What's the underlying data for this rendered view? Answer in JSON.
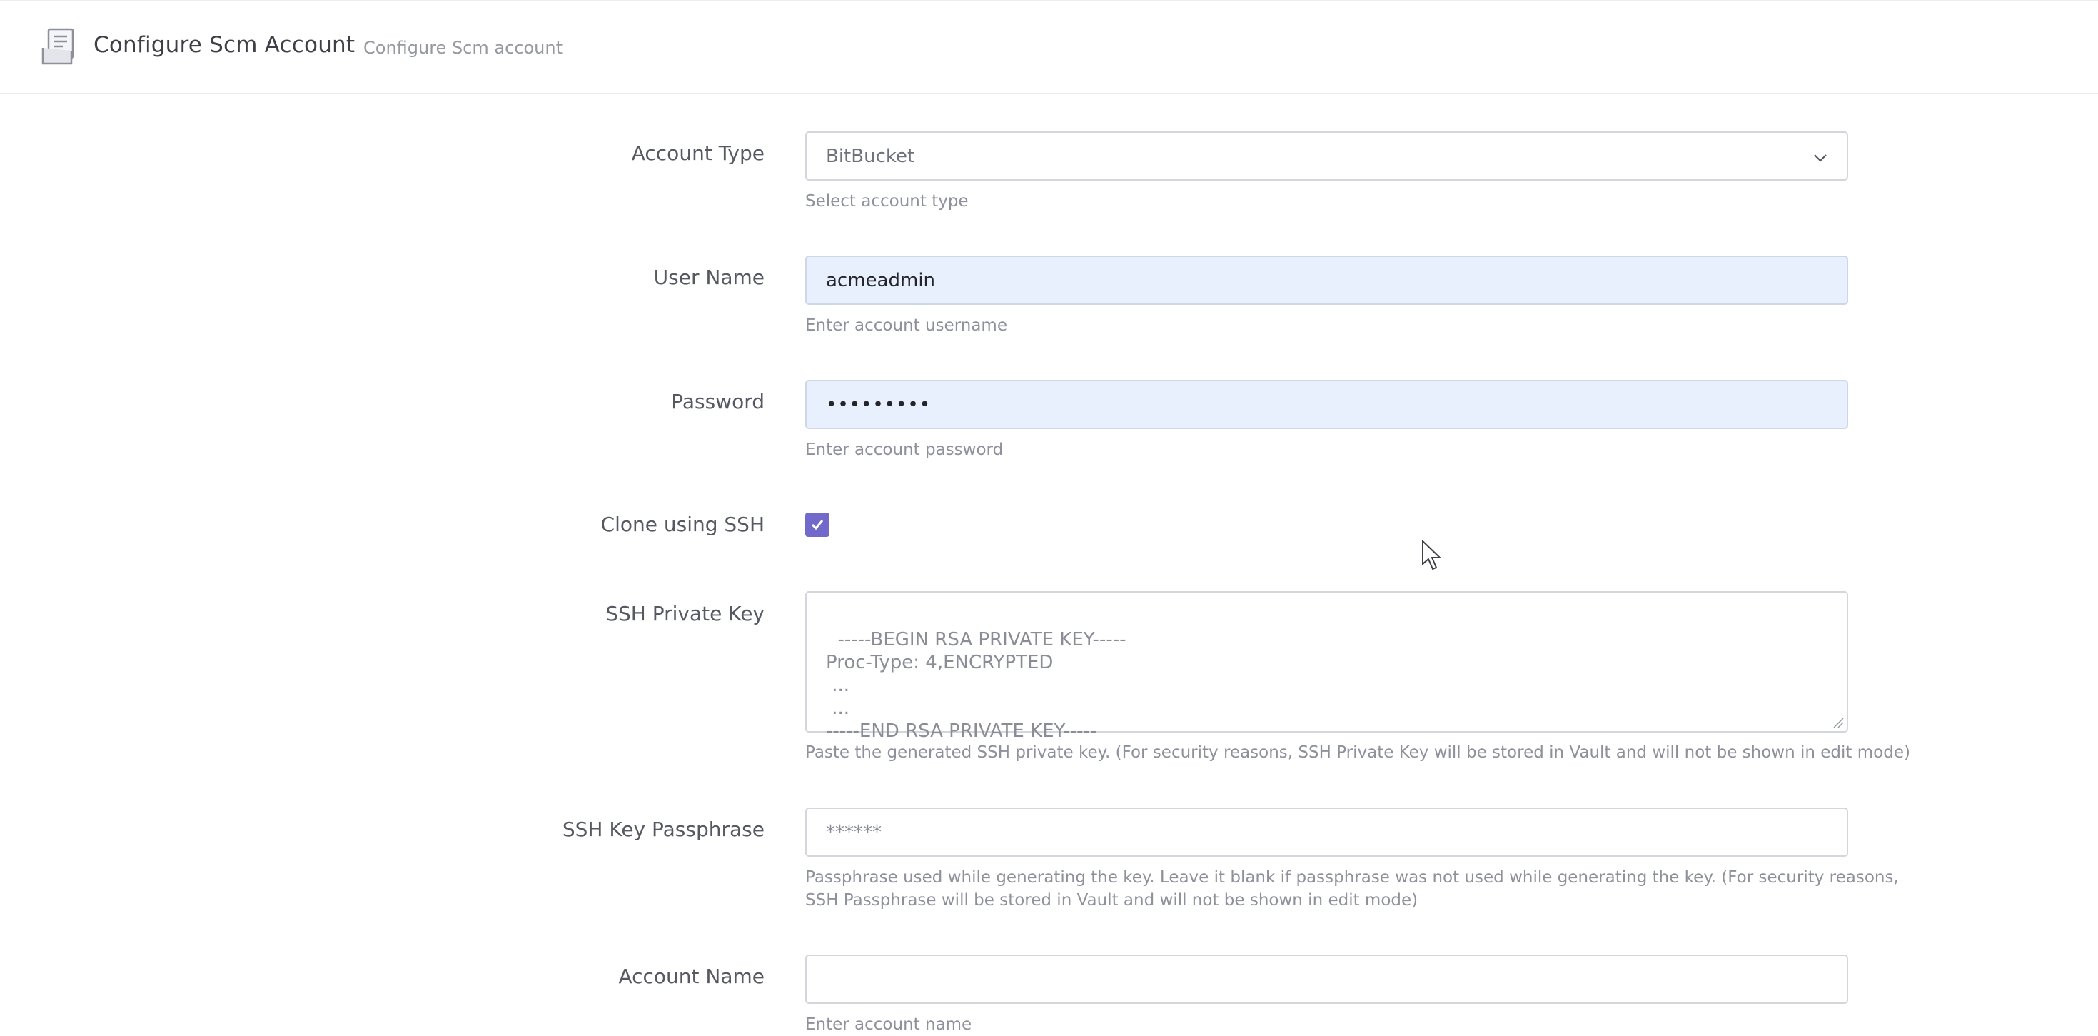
{
  "header": {
    "title": "Configure Scm Account",
    "subtitle": "Configure Scm account",
    "icon": "document-stack-icon"
  },
  "form": {
    "account_type": {
      "label": "Account Type",
      "value": "BitBucket",
      "help": "Select account type"
    },
    "user_name": {
      "label": "User Name",
      "value": "acmeadmin",
      "help": "Enter account username"
    },
    "password": {
      "label": "Password",
      "value": "•••••••••",
      "help": "Enter account password"
    },
    "clone_ssh": {
      "label": "Clone using SSH",
      "checked": true
    },
    "ssh_private_key": {
      "label": "SSH Private Key",
      "placeholder": "-----BEGIN RSA PRIVATE KEY-----\nProc-Type: 4,ENCRYPTED\n ...\n ...\n-----END RSA PRIVATE KEY-----",
      "help": "Paste the generated SSH private key. (For security reasons, SSH Private Key will be stored in Vault and will not be shown in edit mode)"
    },
    "ssh_passphrase": {
      "label": "SSH Key Passphrase",
      "placeholder": "******",
      "help_line1": "Passphrase used while generating the key. Leave it blank if passphrase was not used while generating the key. (For security reasons,",
      "help_line2": "SSH Passphrase will be stored in Vault and will not be shown in edit mode)"
    },
    "account_name": {
      "label": "Account Name",
      "value": "",
      "help": "Enter account name"
    }
  },
  "colors": {
    "accent": "#716aca",
    "autofill_bg": "#e8effd"
  }
}
